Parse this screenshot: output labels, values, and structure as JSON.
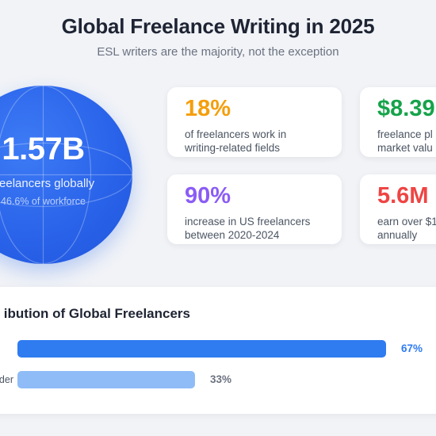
{
  "header": {
    "title": "Global Freelance Writing in 2025",
    "subtitle": "ESL writers are the majority, not the exception"
  },
  "globe": {
    "value": "1.57B",
    "label": "freelancers globally",
    "sublabel": "46.6% of workforce",
    "color": "#2a64ea"
  },
  "stats": [
    {
      "value": "18%",
      "line1": "of freelancers work in",
      "line2": "writing-related fields",
      "color": "#f59e0b"
    },
    {
      "value": "$8.39",
      "line1": "freelance pl",
      "line2": "market valu",
      "color": "#16a34a"
    },
    {
      "value": "90%",
      "line1": "increase in US freelancers",
      "line2": "between 2020-2024",
      "color": "#8b5cf6"
    },
    {
      "value": "5.6M",
      "line1": "earn over $1",
      "line2": "annually",
      "color": "#ef4444"
    }
  ],
  "distribution": {
    "title": "ibution of Global Freelancers",
    "rows": [
      {
        "label": "",
        "percent_label": "67%",
        "fraction": 0.67,
        "color": "#2f7bf0",
        "text_color": "#2f7bf0"
      },
      {
        "label": "der",
        "percent_label": "33%",
        "fraction": 0.33,
        "color": "#8fbcf7",
        "text_color": "#6b7280"
      }
    ]
  }
}
